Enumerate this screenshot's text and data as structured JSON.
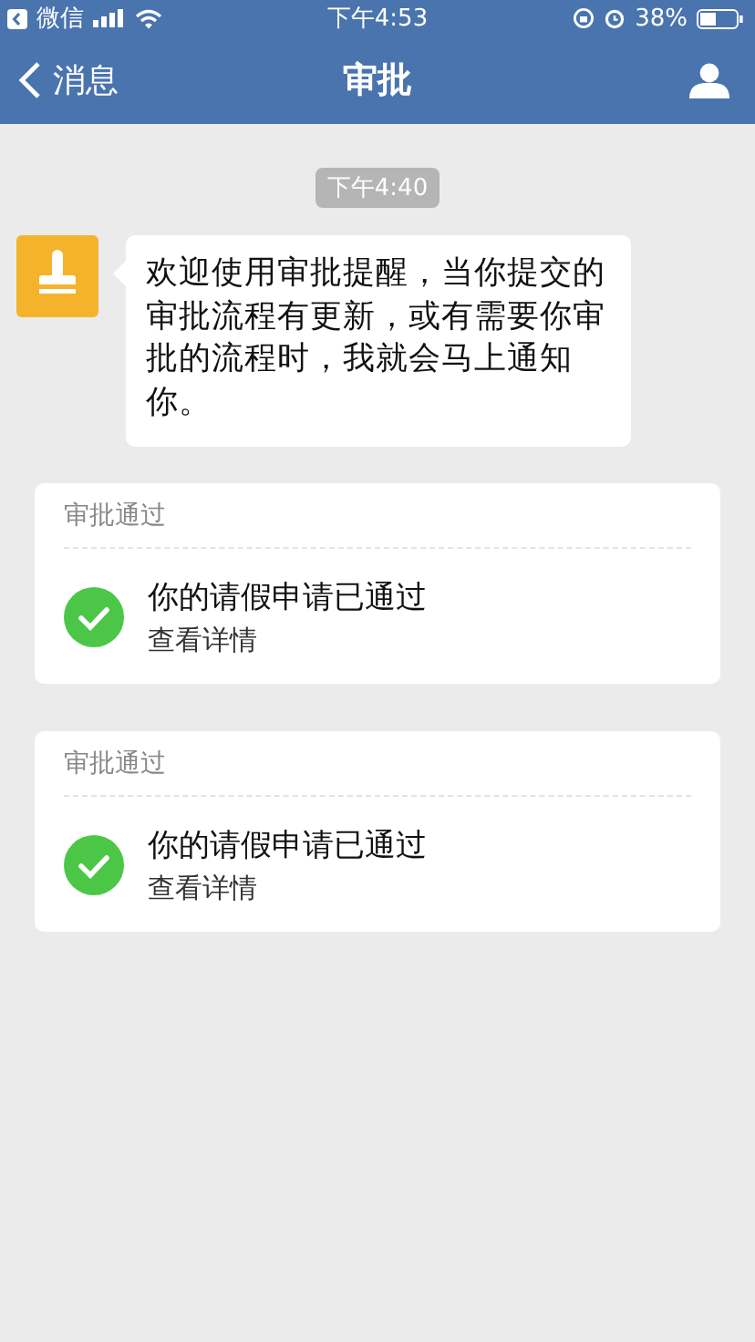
{
  "status_bar": {
    "back_app": "微信",
    "time": "下午4:53",
    "battery": "38%"
  },
  "nav": {
    "back": "消息",
    "title": "审批"
  },
  "timestamp": "下午4:40",
  "message": "欢迎使用审批提醒，当你提交的审批流程有更新，或有需要你审批的流程时，我就会马上通知你。",
  "cards": [
    {
      "header": "审批通过",
      "title": "你的请假申请已通过",
      "link": "查看详情"
    },
    {
      "header": "审批通过",
      "title": "你的请假申请已通过",
      "link": "查看详情"
    }
  ]
}
